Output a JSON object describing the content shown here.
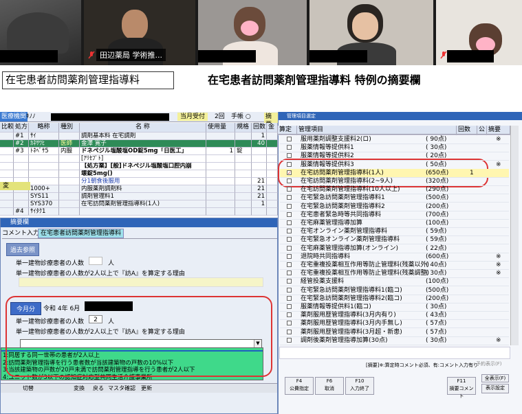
{
  "meeting": {
    "participants": [
      {
        "name": ""
      },
      {
        "name": "田辺薬局 学術推..."
      },
      {
        "name": ""
      },
      {
        "name": ""
      },
      {
        "name": ""
      }
    ]
  },
  "slide": {
    "box_label": "在宅患者訪問薬剤管理指導料",
    "title": "在宅患者訪問薬剤管理指導料  特例の摘要欄"
  },
  "app": {
    "top": {
      "institution_label": "医療機関",
      "institution_value": "ｷﾉﾉ",
      "month_tab": "当月受付",
      "count": "2回",
      "handbook": "手帳 ○",
      "summary_label": "摘要"
    },
    "rx_columns": [
      "比較",
      "処方",
      "略称",
      "種別",
      "名    称",
      "使用量",
      "規格",
      "回数",
      "金"
    ],
    "rx_rows": [
      {
        "no": "#1",
        "abbr": "ｻｲ",
        "kind": "",
        "name": "調剤基本料 在宅調剤",
        "qty": "",
        "unit": "",
        "times": "1"
      },
      {
        "no": "#2",
        "abbr": "ｶﾈｻﾜﾋ",
        "kind": "医師",
        "name": "金澤 寛子",
        "qty": "",
        "unit": "",
        "times": "40"
      },
      {
        "no": "#3",
        "abbr": "ﾄﾈﾍﾞｻ5",
        "kind": "内服",
        "name": "ドネペジル塩酸塩OD錠5mg「日医工」",
        "qty": "1",
        "unit": "錠",
        "times": ""
      },
      {
        "no": "",
        "abbr": "",
        "kind": "",
        "name": "[ｱﾘｾﾌﾟﾄ]",
        "qty": "",
        "unit": "",
        "times": ""
      },
      {
        "no": "",
        "abbr": "",
        "kind": "",
        "name": "【処方薬】[般]ドネペジル塩酸塩口腔内崩",
        "qty": "",
        "unit": "",
        "times": ""
      },
      {
        "no": "",
        "abbr": "",
        "kind": "",
        "name": "壊錠5mg()",
        "qty": "",
        "unit": "",
        "times": ""
      },
      {
        "no": "",
        "abbr": "",
        "kind": "",
        "name": "分1朝食後服用",
        "qty": "",
        "unit": "",
        "times": "21"
      },
      {
        "no": "",
        "abbr": "1000+",
        "kind": "",
        "name": "内服薬剤調剤料",
        "qty": "",
        "unit": "",
        "times": "21"
      },
      {
        "no": "",
        "abbr": "SYS11",
        "kind": "",
        "name": "調剤管理料1",
        "qty": "",
        "unit": "",
        "times": "21"
      },
      {
        "no": "",
        "abbr": "SYS370",
        "kind": "",
        "name": "在宅訪問薬剤管理指導料(1人)",
        "qty": "",
        "unit": "",
        "times": "1"
      },
      {
        "no": "#4",
        "abbr": "ｻｲﾀｸ1",
        "kind": "",
        "name": "",
        "qty": "",
        "unit": "",
        "times": ""
      }
    ],
    "rx_side_label": "変",
    "summary_dialog": {
      "title": "摘要欄",
      "tab_comment": "コメント入力",
      "tab_active": "在宅患者訪問薬剤管理指導料",
      "past_ref": "過去参照",
      "q1_label": "単一建物診療患者の人数",
      "q1_unit": "人",
      "q2_label": "単一建物診療患者の人数が2人以上で『訪A』を算定する理由",
      "this_month": "今月分",
      "era": "令和 4年 6月",
      "q3_label": "単一建物診療患者の人数",
      "q3_value": "2",
      "q3_unit": "人",
      "q4_label": "単一建物診療患者の人数が2人以上で『訪A』を算定する理由",
      "options": [
        "1:同居する同一世帯の患者が2人以上",
        "2:訪問薬剤管理指導を行う患者数が当該建築物の戸数の10%以下",
        "3:当該建築物の戸数が20戸未満で訪問薬剤管理指導を行う患者が2人以下",
        "4:ユニット数が3以下の認知症対応型共同生活介護事業所"
      ],
      "bottom_tabs": [
        "切替",
        "",
        "変換",
        "",
        "戻る",
        "",
        "マスタ確認",
        "",
        "更新"
      ]
    },
    "fee_dialog": {
      "title": "管理項目選定",
      "col_calc": "算定",
      "col_item": "管理項目",
      "col_count": "回数",
      "col_pub": "公",
      "col_summary": "摘要",
      "items": [
        {
          "checked": false,
          "label": "服用薬剤調整支援料2(ロ)",
          "points": "( 90点)",
          "count": "",
          "mark": "※"
        },
        {
          "checked": false,
          "label": "服薬情報等提供料1",
          "points": "( 30点)",
          "count": "",
          "mark": ""
        },
        {
          "checked": false,
          "label": "服薬情報等提供料2",
          "points": "( 20点)",
          "count": "",
          "mark": ""
        },
        {
          "checked": false,
          "label": "服薬情報等提供料3",
          "points": "( 50点)",
          "count": "",
          "mark": "※"
        },
        {
          "checked": true,
          "label": "在宅訪問薬剤管理指導料(1人)",
          "points": "(650点)",
          "count": "1",
          "mark": ""
        },
        {
          "checked": false,
          "label": "在宅訪問薬剤管理指導料(2~9人)",
          "points": "(320点)",
          "count": "",
          "mark": ""
        },
        {
          "checked": false,
          "label": "在宅訪問薬剤管理指導料(10人以上)",
          "points": "(290点)",
          "count": "",
          "mark": ""
        },
        {
          "checked": false,
          "label": "在宅緊急訪問薬剤管理指導料1",
          "points": "(500点)",
          "count": "",
          "mark": ""
        },
        {
          "checked": false,
          "label": "在宅緊急訪問薬剤管理指導料2",
          "points": "(200点)",
          "count": "",
          "mark": ""
        },
        {
          "checked": false,
          "label": "在宅患者緊急時等共同指導料",
          "points": "(700点)",
          "count": "",
          "mark": ""
        },
        {
          "checked": false,
          "label": "在宅麻薬管理指導加算",
          "points": "(100点)",
          "count": "",
          "mark": ""
        },
        {
          "checked": false,
          "label": "在宅オンライン薬剤管理指導料",
          "points": "( 59点)",
          "count": "",
          "mark": ""
        },
        {
          "checked": false,
          "label": "在宅緊急オンライン薬剤管理指導料",
          "points": "( 59点)",
          "count": "",
          "mark": ""
        },
        {
          "checked": false,
          "label": "在宅麻薬管理指導加算(オンライン)",
          "points": "( 22点)",
          "count": "",
          "mark": ""
        },
        {
          "checked": false,
          "label": "退院時共同指導料",
          "points": "(600点)",
          "count": "",
          "mark": "※"
        },
        {
          "checked": false,
          "label": "在宅重複投薬相互作用等防止管理料(残薬以外)",
          "points": "( 40点)",
          "count": "",
          "mark": "※"
        },
        {
          "checked": false,
          "label": "在宅重複投薬相互作用等防止管理料(残薬調整)",
          "points": "( 30点)",
          "count": "",
          "mark": "※"
        },
        {
          "checked": false,
          "label": "経管投薬支援料",
          "points": "(100点)",
          "count": "",
          "mark": ""
        },
        {
          "checked": false,
          "label": "在宅緊急訪問薬剤管理指導料1(臨コ)",
          "points": "(500点)",
          "count": "",
          "mark": ""
        },
        {
          "checked": false,
          "label": "在宅緊急訪問薬剤管理指導料2(臨コ)",
          "points": "(200点)",
          "count": "",
          "mark": ""
        },
        {
          "checked": false,
          "label": "服薬情報等提供料1(臨コ)",
          "points": "( 30点)",
          "count": "",
          "mark": ""
        },
        {
          "checked": false,
          "label": "薬剤服用歴管理指導料(3月内有り)",
          "points": "( 43点)",
          "count": "",
          "mark": ""
        },
        {
          "checked": false,
          "label": "薬剤服用歴管理指導料(3月内手無し)",
          "points": "( 57点)",
          "count": "",
          "mark": ""
        },
        {
          "checked": false,
          "label": "薬剤服用歴管理指導料(3月超・新患)",
          "points": "( 57点)",
          "count": "",
          "mark": ""
        },
        {
          "checked": false,
          "label": "調剤後薬剤管理指導加算(30点)",
          "points": "( 30点)",
          "count": "",
          "mark": "※"
        }
      ],
      "footnote": "[摘要]※:算定時コメント必須、有:コメント入力有り",
      "detail_display": "予約表示(F)"
    },
    "fkeys": [
      {
        "key": "F4",
        "label": "公費指定"
      },
      {
        "key": "F6",
        "label": "取消"
      },
      {
        "key": "F10",
        "label": "入力終了"
      },
      {
        "key": "F11",
        "label": "摘要コメント"
      },
      {
        "key": "",
        "label": "全表示(F)"
      },
      {
        "key": "",
        "label": "表示設定"
      }
    ]
  },
  "colors": {
    "accent_red": "#d33333",
    "selection_blue": "#1f5fbf",
    "dropdown_green": "#3fd98a",
    "header_blue": "#dce4f2"
  }
}
